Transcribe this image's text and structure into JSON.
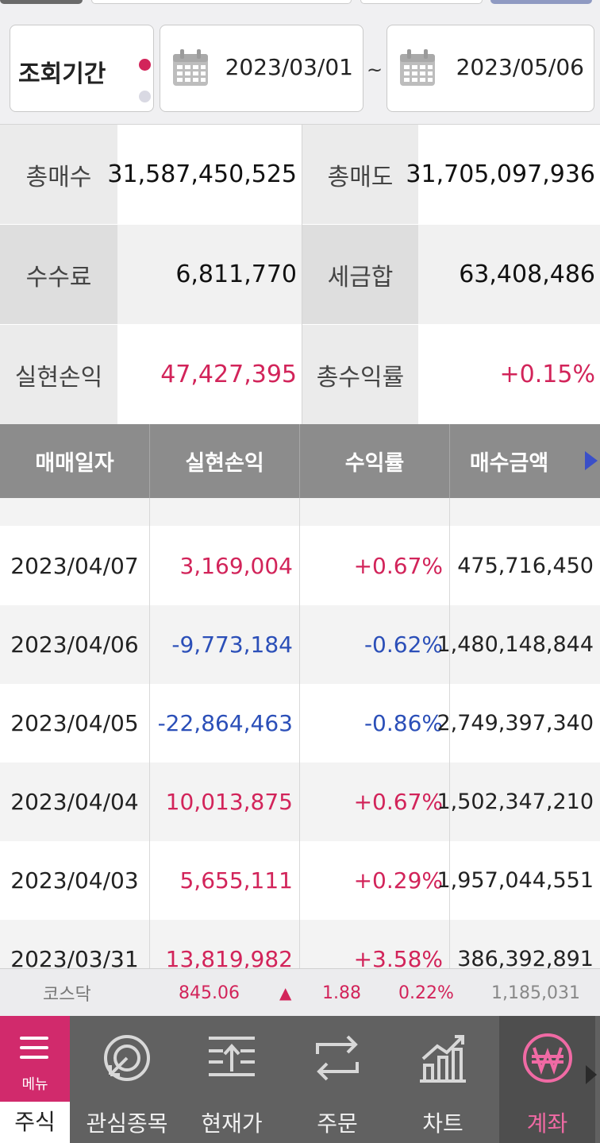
{
  "period": {
    "label": "조회기간",
    "from": "2023/03/01",
    "separator": "~",
    "to": "2023/05/06"
  },
  "summary": {
    "total_buy_label": "총매수",
    "total_buy": "31,587,450,525",
    "total_sell_label": "총매도",
    "total_sell": "31,705,097,936",
    "fee_label": "수수료",
    "fee": "6,811,770",
    "tax_label": "세금합",
    "tax": "63,408,486",
    "realized_label": "실현손익",
    "realized": "47,427,395",
    "return_label": "총수익률",
    "return": "+0.15%"
  },
  "table": {
    "headers": [
      "매매일자",
      "실현손익",
      "수익률",
      "매수금액"
    ],
    "rows": [
      {
        "date": "2023/04/07",
        "pl": "3,169,004",
        "rate": "+0.67%",
        "buy": "475,716,450",
        "sign": "pos"
      },
      {
        "date": "2023/04/06",
        "pl": "-9,773,184",
        "rate": "-0.62%",
        "buy": "1,480,148,844",
        "sign": "neg"
      },
      {
        "date": "2023/04/05",
        "pl": "-22,864,463",
        "rate": "-0.86%",
        "buy": "2,749,397,340",
        "sign": "neg"
      },
      {
        "date": "2023/04/04",
        "pl": "10,013,875",
        "rate": "+0.67%",
        "buy": "1,502,347,210",
        "sign": "pos"
      },
      {
        "date": "2023/04/03",
        "pl": "5,655,111",
        "rate": "+0.29%",
        "buy": "1,957,044,551",
        "sign": "pos"
      },
      {
        "date": "2023/03/31",
        "pl": "13,819,982",
        "rate": "+3.58%",
        "buy": "386,392,891",
        "sign": "pos"
      }
    ]
  },
  "ticker": {
    "name": "코스닥",
    "price": "845.06",
    "arrow": "▲",
    "change": "1.88",
    "pct": "0.22%",
    "volume": "1,185,031"
  },
  "nav": {
    "menu": "메뉴",
    "stock": "주식",
    "watchlist": "관심종목",
    "price": "현재가",
    "order": "주문",
    "chart": "차트",
    "account": "계좌"
  },
  "colors": {
    "positive": "#d2245a",
    "negative": "#2b4fb8",
    "header_bg": "#8c8c8c",
    "nav_bg": "#616161",
    "accent": "#d12a6c"
  }
}
